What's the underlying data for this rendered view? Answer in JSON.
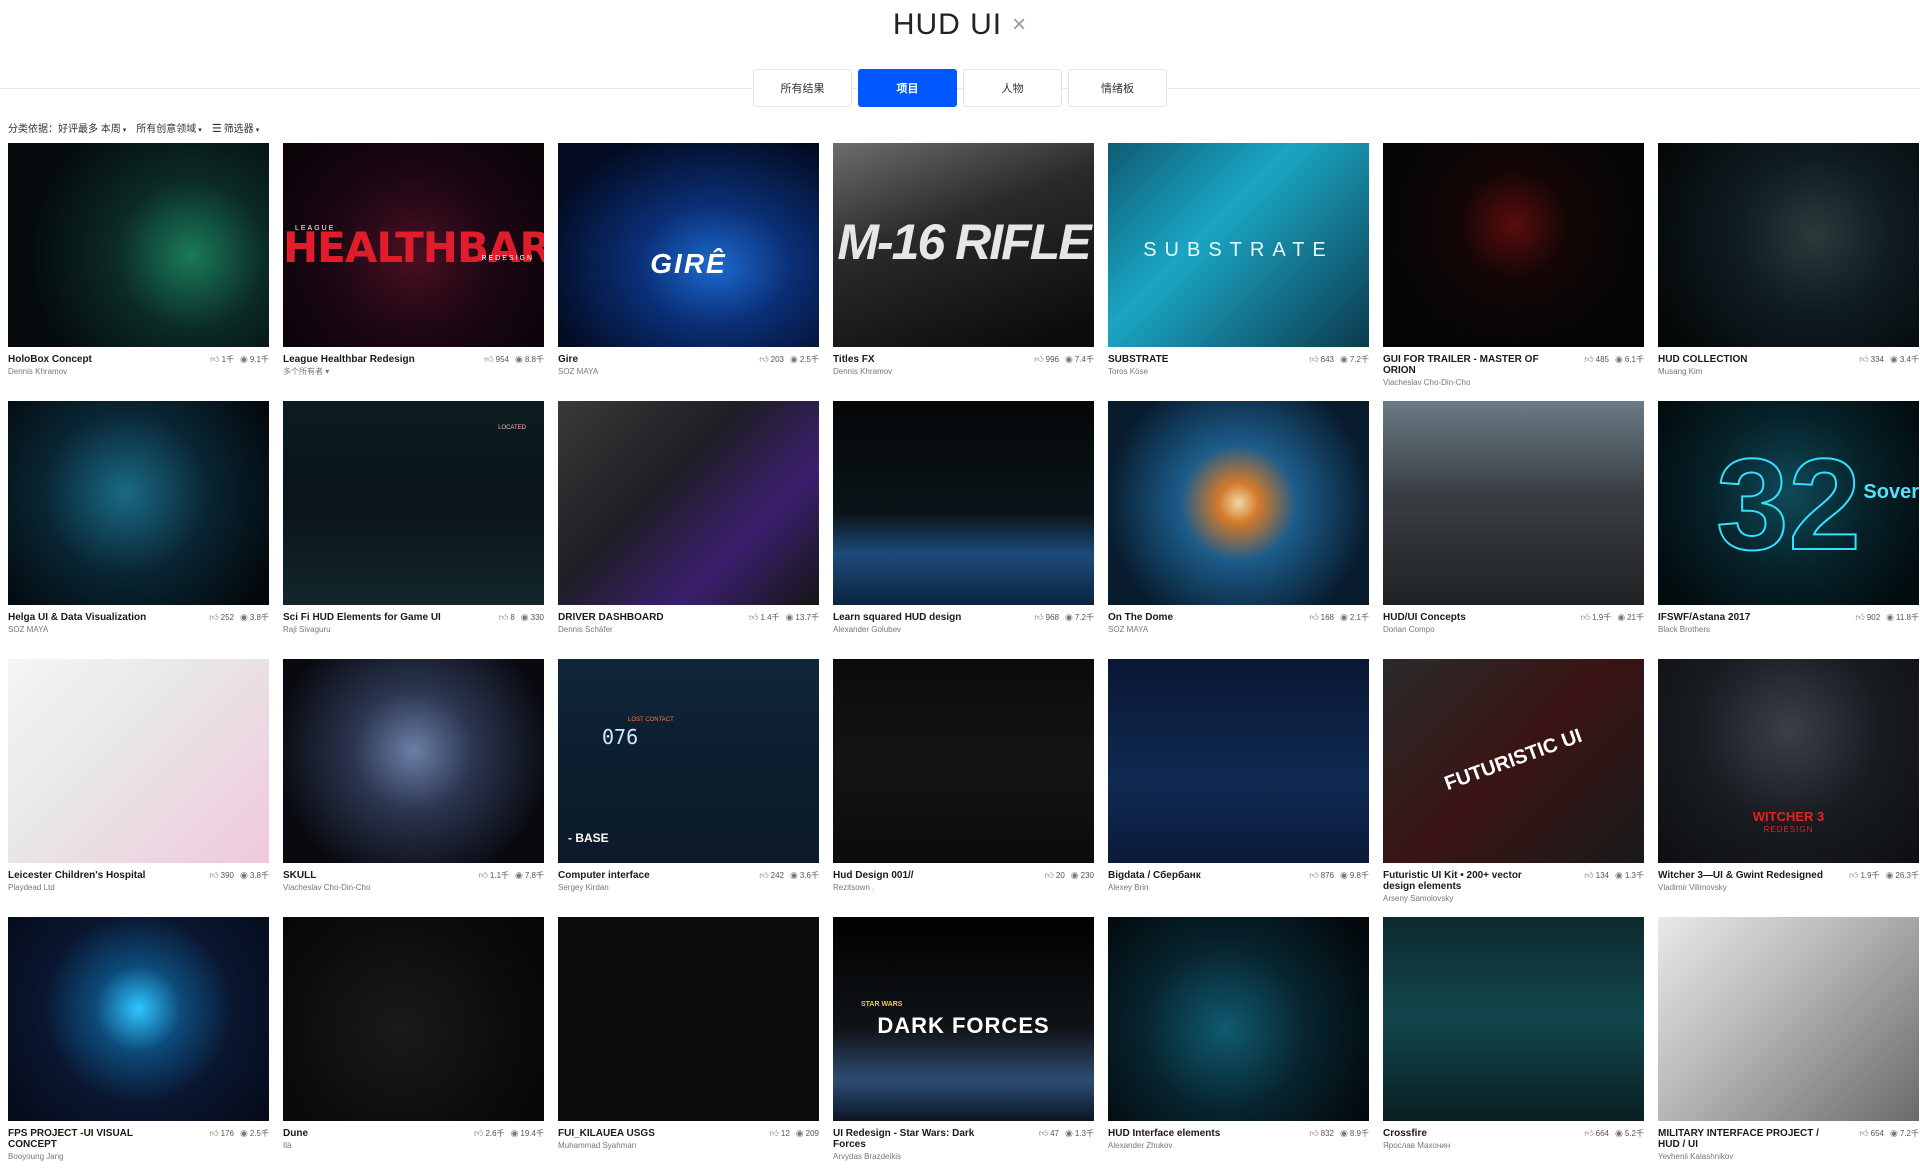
{
  "search": {
    "query": "HUD UI",
    "clear_icon": "×"
  },
  "tabs": [
    {
      "label": "所有结果",
      "active": false
    },
    {
      "label": "项目",
      "active": true
    },
    {
      "label": "人物",
      "active": false
    },
    {
      "label": "情绪板",
      "active": false
    }
  ],
  "filters": {
    "sort": "分类依据：好评最多 本周",
    "fields": "所有创意领域",
    "filter": "筛选器"
  },
  "colors": {
    "accent": "#0057ff"
  },
  "icons": {
    "like": "thumbs-up-icon",
    "view": "eye-icon"
  },
  "projects": [
    {
      "title": "HoloBox Concept",
      "owner": "Dennis Khramov",
      "likes": "1千",
      "views": "9.1千"
    },
    {
      "title": "League Healthbar Redesign",
      "owner": "多个所有者 ▾",
      "likes": "954",
      "views": "8.8千",
      "overlay": {
        "main": "HEALTHBAR",
        "top": "LEAGUE",
        "sub": "REDESIGN"
      }
    },
    {
      "title": "Gire",
      "owner": "SOZ MAYA",
      "likes": "203",
      "views": "2.5千",
      "overlay": {
        "main": "GIRÊ"
      }
    },
    {
      "title": "Titles FX",
      "owner": "Dennis Khramov",
      "likes": "996",
      "views": "7.4千",
      "overlay": {
        "main": "M-16 RIFLE"
      }
    },
    {
      "title": "SUBSTRATE",
      "owner": "Toros Köse",
      "likes": "643",
      "views": "7.2千",
      "overlay": {
        "main": "SUBSTRATE"
      }
    },
    {
      "title": "GUI FOR TRAILER - MASTER OF ORION",
      "owner": "Viacheslav Cho-Din-Cho",
      "likes": "485",
      "views": "6.1千"
    },
    {
      "title": "HUD COLLECTION",
      "owner": "Musang Kim",
      "likes": "334",
      "views": "3.4千"
    },
    {
      "title": "Helga UI & Data Visualization",
      "owner": "SOZ MAYA",
      "likes": "252",
      "views": "3.8千"
    },
    {
      "title": "Sci Fi HUD Elements for Game UI",
      "owner": "Raji Sivaguru",
      "likes": "8",
      "views": "330",
      "overlay": {
        "main": "LOCATED"
      }
    },
    {
      "title": "DRIVER DASHBOARD",
      "owner": "Dennis Schäfer",
      "likes": "1.4千",
      "views": "13.7千"
    },
    {
      "title": "Learn squared HUD design",
      "owner": "Alexander Golubev",
      "likes": "968",
      "views": "7.2千"
    },
    {
      "title": "On The Dome",
      "owner": "SOZ MAYA",
      "likes": "168",
      "views": "2.1千"
    },
    {
      "title": "HUD/UI Concepts",
      "owner": "Dorian Compo",
      "likes": "1.9千",
      "views": "21千"
    },
    {
      "title": "IFSWF/Astana 2017",
      "owner": "Black Brothers",
      "likes": "902",
      "views": "11.8千",
      "overlay": {
        "main": "32",
        "sub": "Sover"
      }
    },
    {
      "title": "Leicester Children's Hospital",
      "owner": "Playdead Ltd",
      "likes": "390",
      "views": "3.8千"
    },
    {
      "title": "SKULL",
      "owner": "Viacheslav Cho-Din-Cho",
      "likes": "1.1千",
      "views": "7.8千"
    },
    {
      "title": "Computer interface",
      "owner": "Sergey Kirdan",
      "likes": "242",
      "views": "3.6千",
      "overlay": {
        "main": "- BASE",
        "num": "076",
        "top": "LOST CONTACT"
      }
    },
    {
      "title": "Hud Design 001//",
      "owner": "Rezitsown .",
      "likes": "20",
      "views": "230"
    },
    {
      "title": "Bigdata / Сбербанк",
      "owner": "Alexey Brin",
      "likes": "876",
      "views": "9.8千"
    },
    {
      "title": "Futuristic UI Kit • 200+ vector design elements",
      "owner": "Arseny Samolovsky",
      "likes": "134",
      "views": "1.3千",
      "overlay": {
        "main": "FUTURISTIC UI"
      }
    },
    {
      "title": "Witcher 3—UI & Gwint Redesigned",
      "owner": "Vladimir Vilimovsky",
      "likes": "1.9千",
      "views": "26.3千",
      "overlay": {
        "main": "WITCHER 3",
        "sub": "REDESIGN"
      }
    },
    {
      "title": "FPS PROJECT -UI VISUAL CONCEPT",
      "owner": "Booyoung Jang",
      "likes": "176",
      "views": "2.5千"
    },
    {
      "title": "Dune",
      "owner": "Ilà",
      "likes": "2.6千",
      "views": "19.4千"
    },
    {
      "title": "FUI_KILAUEA USGS",
      "owner": "Muhammad Syahman",
      "likes": "12",
      "views": "209"
    },
    {
      "title": "UI Redesign - Star Wars: Dark Forces",
      "owner": "Arvydas Brazdeikis",
      "likes": "47",
      "views": "1.3千",
      "overlay": {
        "main": "DARK FORCES",
        "top": "STAR WARS"
      }
    },
    {
      "title": "HUD Interface elements",
      "owner": "Alexander Zhukov",
      "likes": "832",
      "views": "8.9千"
    },
    {
      "title": "Crossfire",
      "owner": "Ярослав Махонин",
      "likes": "664",
      "views": "5.2千"
    },
    {
      "title": "MILITARY INTERFACE PROJECT / HUD / UI",
      "owner": "Yevhenii Kalashnikov",
      "likes": "654",
      "views": "7.2千"
    }
  ]
}
